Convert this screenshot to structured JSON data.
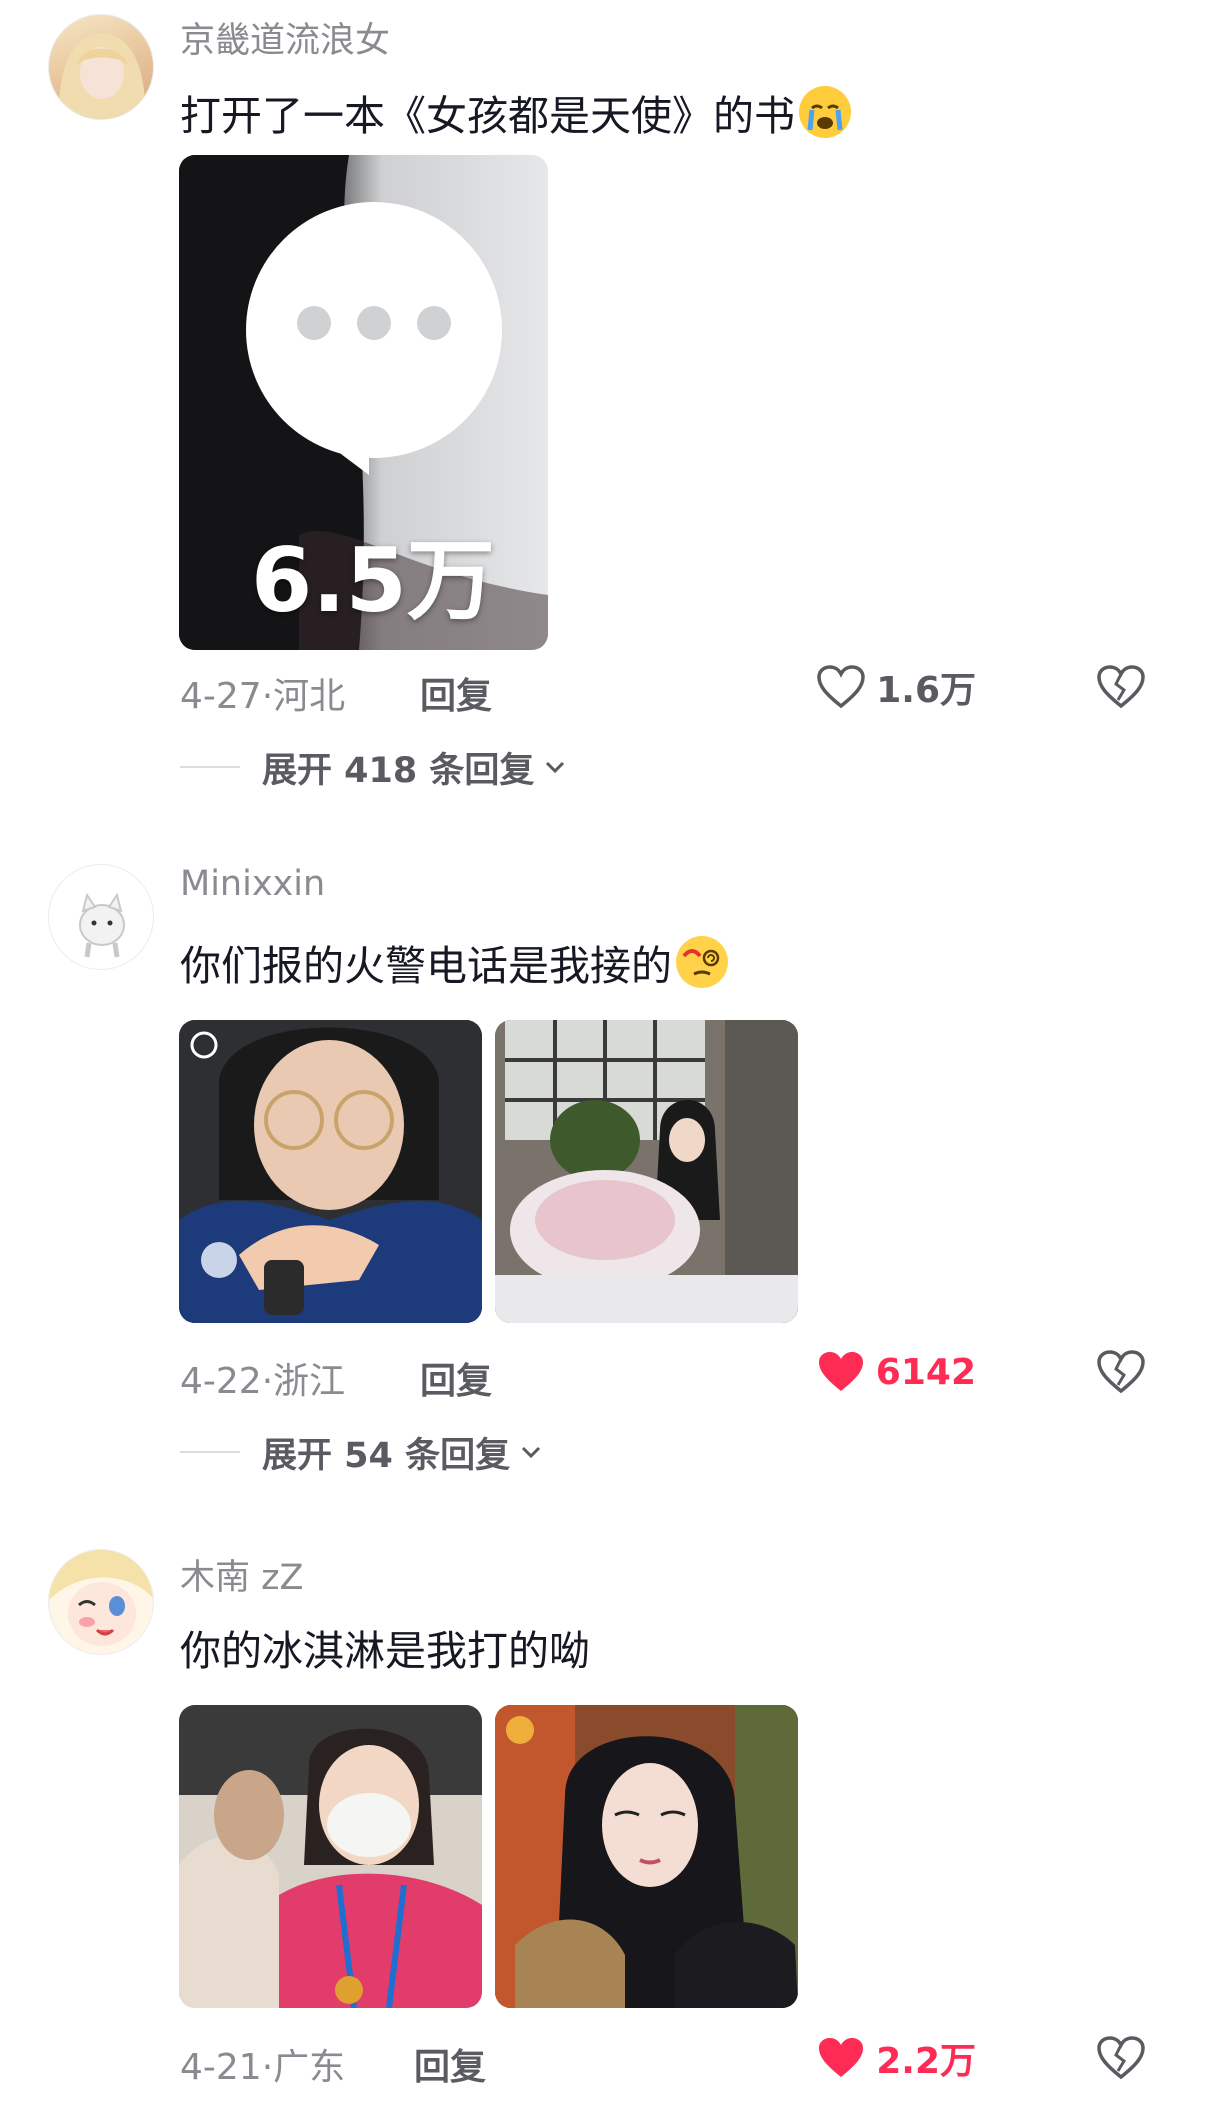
{
  "comments": [
    {
      "username": "京畿道流浪女",
      "text": "打开了一本《女孩都是天使》的书",
      "emoji": "crying-face",
      "image_overlay_count": "6.5万",
      "date": "4-27",
      "location": "河北",
      "reply_label": "回复",
      "like_count": "1.6万",
      "liked": false,
      "expand_label": "展开 418 条回复"
    },
    {
      "username": "Minixxin",
      "text": "你们报的火警电话是我接的",
      "emoji": "dizzy-face",
      "date": "4-22",
      "location": "浙江",
      "reply_label": "回复",
      "like_count": "6142",
      "liked": true,
      "expand_label": "展开 54 条回复"
    },
    {
      "username": "木南 zZ",
      "text": "你的冰淇淋是我打的呦",
      "date": "4-21",
      "location": "广东",
      "reply_label": "回复",
      "like_count": "2.2万",
      "liked": true
    }
  ],
  "colors": {
    "liked": "#fe2c55",
    "muted": "#8a8b91",
    "reply": "#5a5b61"
  },
  "icons": [
    "heart-outline-icon",
    "heart-filled-icon",
    "broken-heart-icon",
    "chevron-down-icon"
  ]
}
